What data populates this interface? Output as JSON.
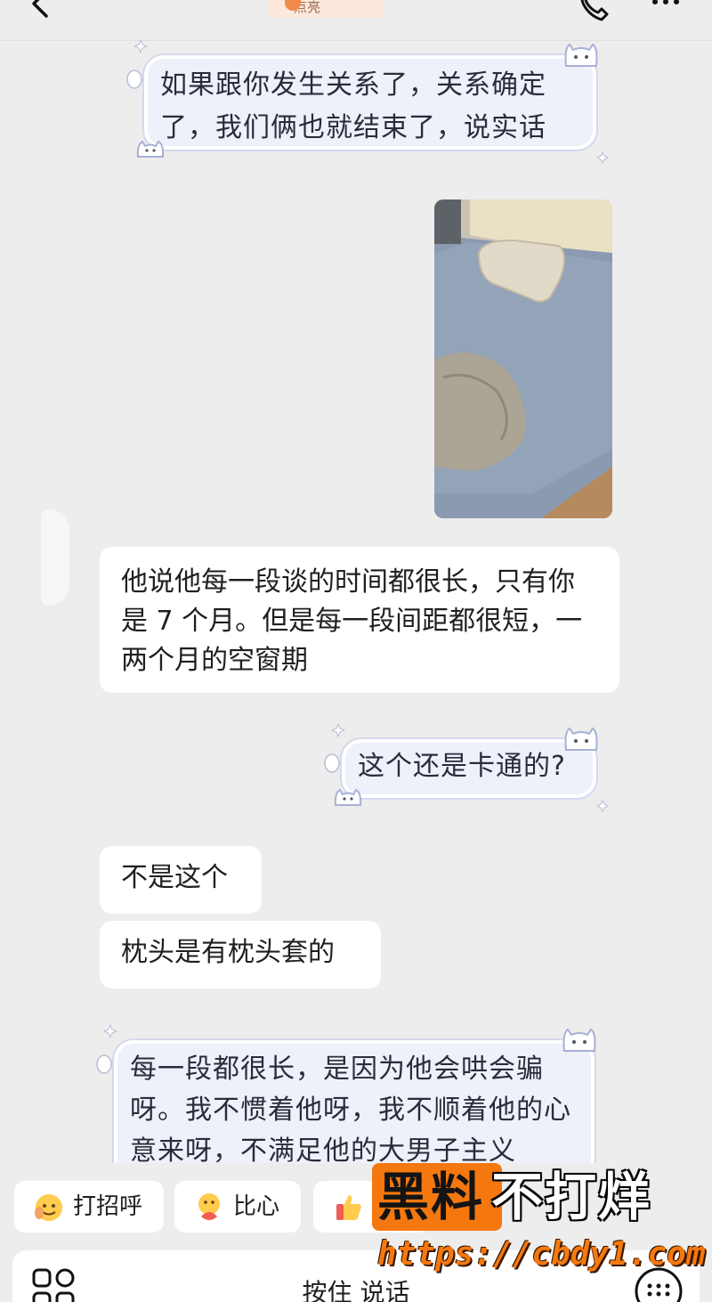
{
  "header": {
    "title_fragment": "点亮"
  },
  "messages": [
    {
      "id": "m1",
      "side": "right",
      "style": "cloud",
      "text": "如果跟你发生关系了，关系确定了，我们俩也就结束了，说实话"
    },
    {
      "id": "m2",
      "side": "right",
      "style": "photo",
      "image": "bed-photo"
    },
    {
      "id": "m3",
      "side": "left",
      "style": "plain",
      "text": "他说他每一段谈的时间都很长，只有你是 7 个月。但是每一段间距都很短，一两个月的空窗期"
    },
    {
      "id": "m4",
      "side": "right",
      "style": "cloud",
      "text": "这个还是卡通的?"
    },
    {
      "id": "m5",
      "side": "left",
      "style": "plain",
      "text": "不是这个"
    },
    {
      "id": "m6",
      "side": "left",
      "style": "plain",
      "text": "枕头是有枕头套的"
    },
    {
      "id": "m7",
      "side": "right",
      "style": "cloud",
      "text": "每一段都很长，是因为他会哄会骗呀。我不惯着他呀，我不顺着他的心意来呀，不满足他的大男子主义"
    }
  ],
  "quick_replies": [
    {
      "label": "打招呼",
      "icon": "wave-emoji-icon"
    },
    {
      "label": "比心",
      "icon": "heart-hands-emoji-icon"
    },
    {
      "label": "",
      "icon": "thumbs-up-emoji-icon"
    }
  ],
  "input": {
    "hold_to_talk": "按住 说话"
  },
  "watermark": {
    "brand_part1": "黑料",
    "brand_part2": "不打烊",
    "url": "https://cbdy1.com"
  },
  "colors": {
    "background": "#ededed",
    "cloud_bubble": "#eef0fa",
    "plain_bubble": "#ffffff",
    "watermark_orange": "#f5780f"
  }
}
